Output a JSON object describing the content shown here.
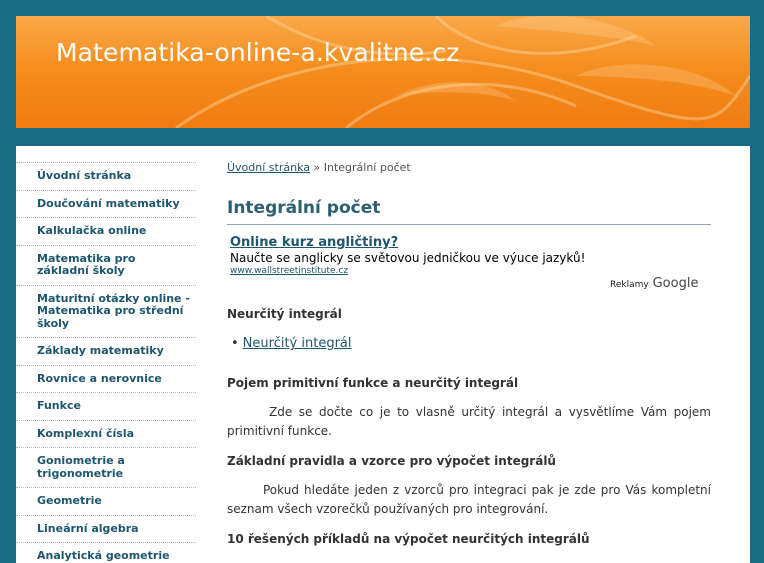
{
  "header": {
    "site_title": "Matematika-online-a.kvalitne.cz"
  },
  "sidebar": {
    "items": [
      {
        "label": "Úvodní stránka"
      },
      {
        "label": "Doučování matematiky"
      },
      {
        "label": "Kalkulačka online"
      },
      {
        "label": "Matematika pro základní školy"
      },
      {
        "label": "Maturitní otázky online - Matematika pro střední školy"
      },
      {
        "label": "Základy matematiky"
      },
      {
        "label": "Rovnice a nerovnice"
      },
      {
        "label": "Funkce"
      },
      {
        "label": "Komplexní čísla"
      },
      {
        "label": "Goniometrie a trigonometrie"
      },
      {
        "label": "Geometrie"
      },
      {
        "label": "Lineární algebra"
      },
      {
        "label": "Analytická geometrie"
      }
    ]
  },
  "breadcrumb": {
    "home": "Úvodní stránka",
    "separator": "»",
    "current": "Integrální počet"
  },
  "page": {
    "title": "Integrální počet"
  },
  "ad": {
    "title": "Online kurz angličtiny?",
    "text": "Naučte se anglicky se světovou jedničkou ve výuce jazyků!",
    "url": "www.wallstreetinstitute.cz",
    "label_prefix": "Reklamy",
    "label_brand": "Google"
  },
  "sections": {
    "indefinite_heading": "Neurčitý integrál",
    "indefinite_link": "Neurčitý integrál",
    "primitive_heading": "Pojem primitivní funkce a neurčitý integrál",
    "primitive_text": "Zde se dočte co je to vlasně určitý integrál a vysvětlíme Vám pojem primitivní funkce.",
    "rules_heading": "Základní pravidla a vzorce pro výpočet integrálů",
    "rules_text": "Pokud hledáte jeden z vzorců pro integraci pak je zde pro Vás kompletní seznam všech vzorečků používaných pro integrování.",
    "examples_heading": "10 řešených příkladů na výpočet neurčitých integrálů"
  },
  "colors": {
    "background": "#176b82",
    "header_orange": "#f58e1f",
    "link": "#1d566e",
    "title": "#2d5f73"
  }
}
